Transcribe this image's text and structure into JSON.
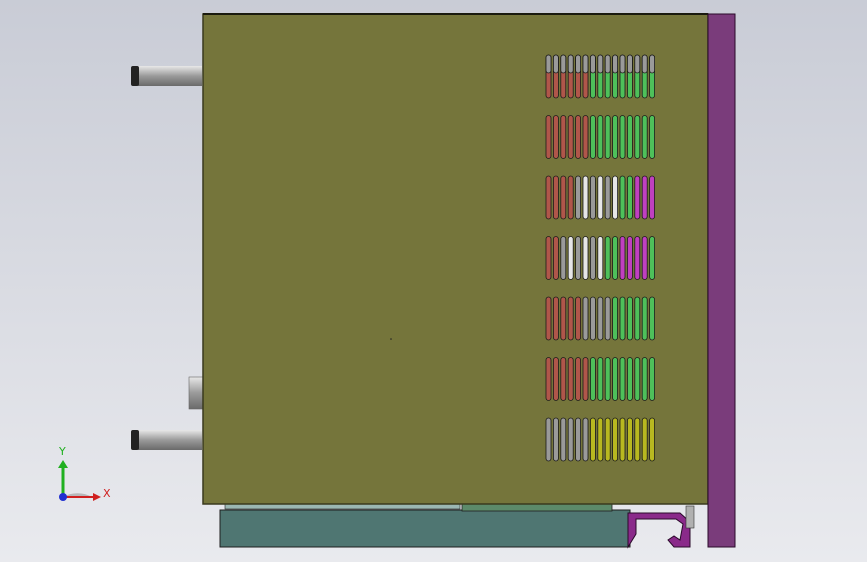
{
  "viewport": {
    "background_top": "#c9ccd6",
    "background_bottom": "#e9eaee"
  },
  "colors": {
    "panel": "#75753b",
    "panel_edge": "#3a3a1e",
    "side_bar": "#7a3c7b",
    "bottom_tray": "#4f7672",
    "bottom_strip": "#5c8a6a",
    "hook": "#8a2a8a",
    "post_dark": "#222222",
    "slot_red": "#b0564a",
    "slot_green": "#4ec05a",
    "slot_gray": "#9a9a9a",
    "slot_white": "#e6e6e6",
    "slot_magenta": "#c040c0",
    "slot_yellow": "#b8b820"
  },
  "vent": {
    "rows": 7,
    "slots_per_row": 15
  },
  "triad": {
    "x_label": "X",
    "y_label": "Y",
    "x_color": "#d02020",
    "y_color": "#20b020",
    "z_color": "#2030d0"
  }
}
